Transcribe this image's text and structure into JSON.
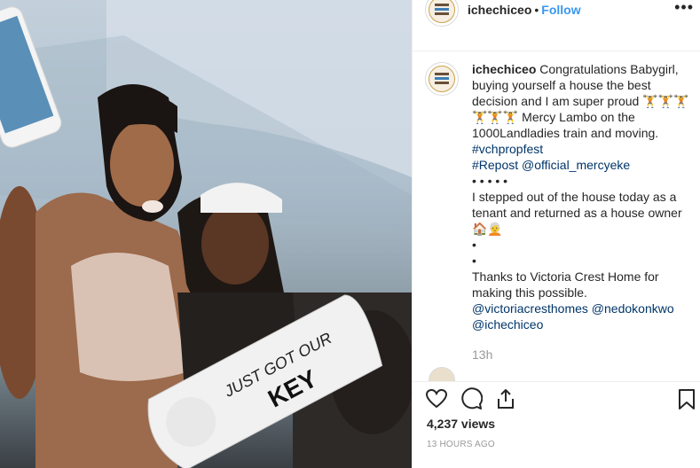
{
  "post": {
    "username": "ichechiceo",
    "follow_label": "Follow",
    "more_icon": "•••",
    "caption_lines": [
      {
        "text": "Congratulations Babygirl,",
        "user": "ichechiceo"
      },
      {
        "text": "buying yourself a house the best"
      },
      {
        "text": "decision and I am super proud 🏋🏋🏋"
      },
      {
        "text": "🏋🏋🏋 Mercy Lambo on the"
      },
      {
        "text": "1000Landladies train and moving."
      },
      {
        "text": "#vchpropfest",
        "link": true
      },
      {
        "text": "#Repost @official_mercyeke",
        "link": true
      },
      {
        "text": "• • • • •"
      },
      {
        "text": "I stepped out of the house today as a"
      },
      {
        "text": "tenant and returned as a house owner"
      },
      {
        "text": "🏠🧑‍🦳"
      },
      {
        "text": "•"
      },
      {
        "text": "•"
      },
      {
        "text": "Thanks to Victoria Crest Home for"
      },
      {
        "text": "making this possible."
      },
      {
        "text": "@victoriacresthomes @nedokonkwo",
        "link": true
      },
      {
        "text": "@ichechiceo",
        "link": true
      }
    ],
    "comment_time": "13h",
    "views": "4,237 views",
    "time_ago": "13 HOURS AGO",
    "video_sign_text_1": "JUST GOT OUR",
    "video_sign_text_2": "KEY",
    "colors": {
      "link": "#003569",
      "follow": "#3897f0",
      "muted": "#999999",
      "text": "#262626"
    },
    "icons": [
      "heart-icon",
      "comment-icon",
      "share-icon",
      "bookmark-icon",
      "more-options-icon"
    ]
  }
}
